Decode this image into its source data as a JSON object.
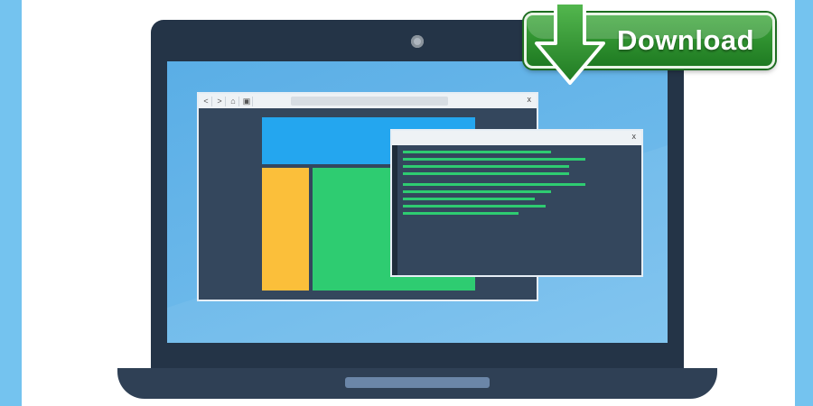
{
  "download": {
    "label": "Download",
    "icon": "download-arrow-icon",
    "color": "#2e8f2f"
  },
  "browser_window": {
    "nav_back": "<",
    "nav_forward": ">",
    "close": "x",
    "wireframe_colors": [
      "#24a6ef",
      "#fbbf3a",
      "#2ecc71"
    ]
  },
  "terminal_window": {
    "close": "x",
    "line_color": "#2ecc71"
  },
  "colors": {
    "laptop": "#243447",
    "screen": "#5aaee6",
    "side_bars": "#74c3ef"
  }
}
